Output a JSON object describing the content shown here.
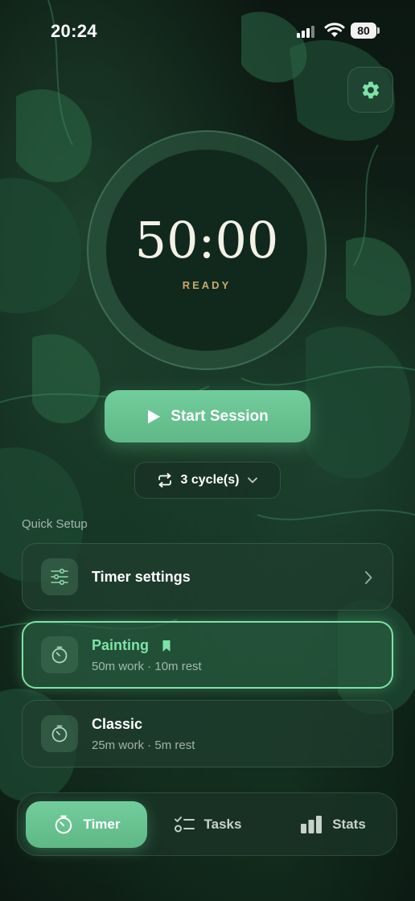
{
  "status_bar": {
    "time": "20:24",
    "battery": "80"
  },
  "icons": {
    "settings": "gear-icon",
    "play": "play-icon",
    "cycle": "repeat-icon",
    "dropdown": "chevron-down-icon",
    "timer_settings": "sliders-icon",
    "preset": "timer-icon",
    "bookmark": "bookmark-icon"
  },
  "colors": {
    "accent": "#72cd9c",
    "active_text": "#7ee2a8",
    "status_gold": "#c9a86a"
  },
  "timer": {
    "time": "50:00",
    "status": "READY"
  },
  "actions": {
    "start_label": "Start Session",
    "cycles_label": "3 cycle(s)"
  },
  "quick_setup": {
    "title": "Quick Setup",
    "timer_settings_label": "Timer settings",
    "presets": [
      {
        "name": "Painting",
        "detail": "50m work · 10m rest",
        "selected": true,
        "bookmarked": true
      },
      {
        "name": "Classic",
        "detail": "25m work · 5m rest",
        "selected": false,
        "bookmarked": false
      }
    ]
  },
  "tabs": [
    {
      "label": "Timer",
      "icon": "timer-icon",
      "active": true
    },
    {
      "label": "Tasks",
      "icon": "checklist-icon",
      "active": false
    },
    {
      "label": "Stats",
      "icon": "bar-chart-icon",
      "active": false
    }
  ]
}
